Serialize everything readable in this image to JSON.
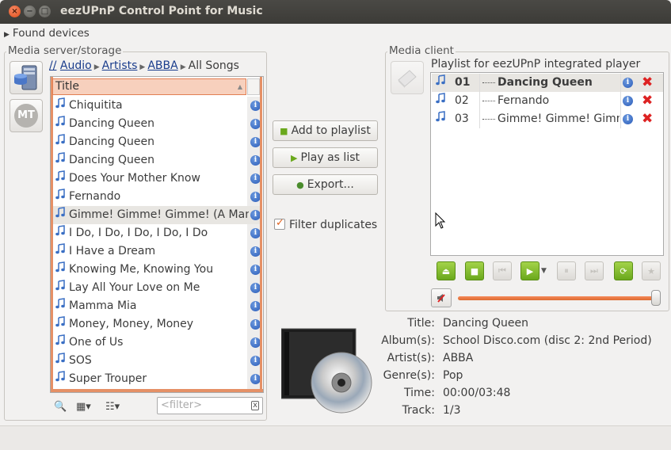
{
  "window": {
    "title": "eezUPnP Control Point for Music",
    "close_glyph": "×",
    "min_glyph": "−",
    "max_glyph": "□"
  },
  "found_devices": "Found devices",
  "server_panel": {
    "label": "Media server/storage",
    "breadcrumb": [
      "//",
      "Audio",
      "Artists",
      "ABBA",
      "All Songs"
    ],
    "column_title": "Title",
    "songs": [
      "Chiquitita",
      "Dancing Queen",
      "Dancing Queen",
      "Dancing Queen",
      "Does Your Mother Know",
      "Fernando",
      "Gimme! Gimme! Gimme! (A Man After Midnight)",
      "I Do, I Do, I Do, I Do, I Do",
      "I Have a Dream",
      "Knowing Me, Knowing You",
      "Lay All Your Love on Me",
      "Mamma Mia",
      "Money, Money, Money",
      "One of Us",
      "SOS",
      "Super Trouper"
    ],
    "selected_index": 6,
    "filter_placeholder": "<filter>",
    "filter_clear": "x",
    "side_button_2": "MT"
  },
  "actions": {
    "add_to_playlist": "Add to playlist",
    "play_as_list": "Play as list",
    "export": "Export...",
    "filter_duplicates": "Filter duplicates",
    "filter_duplicates_checked": true
  },
  "client_panel": {
    "label": "Media client",
    "playlist_title": "Playlist for eezUPnP integrated player",
    "playlist": [
      {
        "num": "01",
        "title": "Dancing Queen"
      },
      {
        "num": "02",
        "title": "Fernando"
      },
      {
        "num": "03",
        "title": "Gimme! Gimme! Gimme! (A Man After Midnight)"
      }
    ],
    "selected_index": 0,
    "volume": 1.0
  },
  "now_playing": {
    "labels": {
      "title": "Title:",
      "album": "Album(s):",
      "artist": "Artist(s):",
      "genre": "Genre(s):",
      "time": "Time:",
      "track": "Track:"
    },
    "title": "Dancing Queen",
    "album": "School Disco.com (disc 2: 2nd Period)",
    "artist": "ABBA",
    "genre": "Pop",
    "time": "00:00/03:48",
    "track": "1/3"
  },
  "icons": {
    "note": "music-note-icon",
    "info": "info-icon",
    "delete": "delete-icon",
    "info_glyph": "i"
  },
  "colors": {
    "accent": "#e59066",
    "header_fill": "#f7d0bd",
    "play_green": "#6aa81c",
    "delete_red": "#dd2222",
    "link": "#1a3d8c"
  }
}
